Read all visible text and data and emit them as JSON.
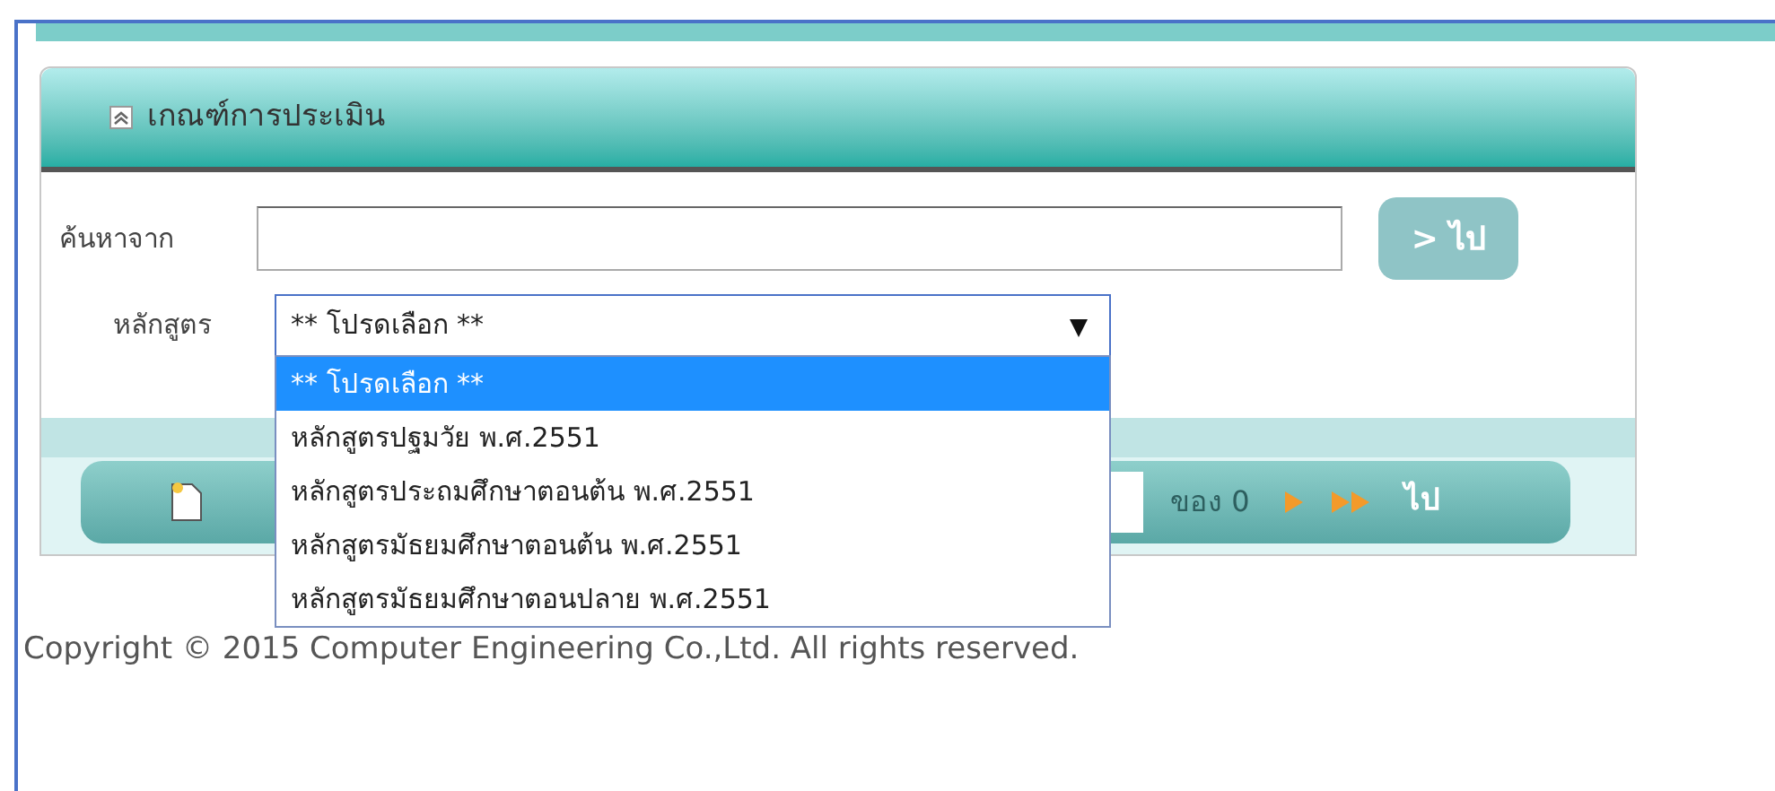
{
  "panel": {
    "title": "เกณฑ์การประเมิน",
    "expanded": true
  },
  "search": {
    "label": "ค้นหาจาก",
    "go_button": "> ไป"
  },
  "course": {
    "label": "หลักสูตร",
    "value": "** โปรดเลือก **",
    "open": true,
    "options": [
      {
        "label": "** โปรดเลือก **",
        "selected": true
      },
      {
        "label": "หลักสูตรปฐมวัย พ.ศ.2551",
        "selected": false
      },
      {
        "label": "หลักสูตรประถมศึกษาตอนต้น พ.ศ.2551",
        "selected": false
      },
      {
        "label": "หลักสูตรมัธยมศึกษาตอนต้น พ.ศ.2551",
        "selected": false
      },
      {
        "label": "หลักสูตรมัธยมศึกษาตอนปลาย พ.ศ.2551",
        "selected": false
      }
    ]
  },
  "pager": {
    "of_label": "ของ 0",
    "go": "ไป"
  },
  "footer": "Copyright © 2015 Computer Engineering Co.,Ltd. All rights reserved."
}
